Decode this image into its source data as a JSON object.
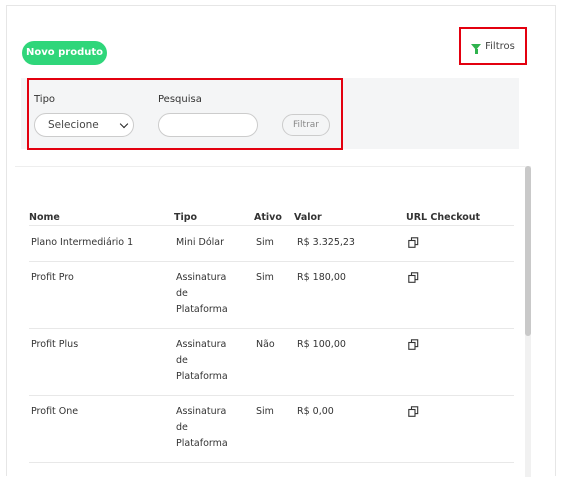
{
  "toolbar": {
    "new_product_label": "Novo produto",
    "filters_label": "Filtros"
  },
  "filters": {
    "tipo_label": "Tipo",
    "tipo_selected": "Selecione",
    "pesquisa_label": "Pesquisa",
    "pesquisa_value": "",
    "filtrar_label": "Filtrar"
  },
  "table": {
    "headers": [
      "Nome",
      "Tipo",
      "Ativo",
      "Valor",
      "URL Checkout"
    ],
    "rows": [
      {
        "nome": "Plano Intermediário 1",
        "tipo": [
          "Mini Dólar"
        ],
        "ativo": "Sim",
        "valor": "R$ 3.325,23",
        "url_icon": "copy-icon"
      },
      {
        "nome": "Profit Pro",
        "tipo": [
          "Assinatura",
          "de",
          "Plataforma"
        ],
        "ativo": "Sim",
        "valor": "R$ 180,00",
        "url_icon": "copy-icon"
      },
      {
        "nome": "Profit Plus",
        "tipo": [
          "Assinatura",
          "de",
          "Plataforma"
        ],
        "ativo": "Não",
        "valor": "R$ 100,00",
        "url_icon": "copy-icon"
      },
      {
        "nome": "Profit One",
        "tipo": [
          "Assinatura",
          "de",
          "Plataforma"
        ],
        "ativo": "Sim",
        "valor": "R$ 0,00",
        "url_icon": "copy-icon"
      }
    ]
  },
  "colors": {
    "accent_green": "#2fd67a",
    "highlight_red": "#e3000f"
  }
}
